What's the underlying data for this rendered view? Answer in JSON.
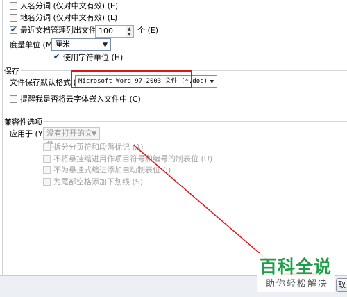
{
  "display": {
    "person_name_label": "人名分词 (仅对中文有效) (E)",
    "place_name_label": "地名分词 (仅对中文有效) (L)",
    "recent_docs_label": "最近文档管理列出文件 (R):",
    "recent_docs_value": "100",
    "recent_docs_unit": "个 (E)",
    "measure_unit_label": "度量单位 (M):",
    "measure_unit_value": "厘米",
    "char_unit_label": "使用字符单位 (H)"
  },
  "save": {
    "section_title": "保存",
    "default_format_label": "文件保存默认格式 (F):",
    "default_format_value": "Microsoft Word 97-2003 文件 (*.doc)",
    "cloud_font_label": "提醒我是否将云字体嵌入文件中 (C)"
  },
  "compat": {
    "section_title": "兼容性选项",
    "apply_to_label": "应用于 (Y):",
    "apply_to_value": "没有打开的文档",
    "options": [
      "拆分分页符和段落标记 (A)",
      "不将悬挂缩进用作项目符号和编号的制表位 (U)",
      "不为悬挂式缩进添加自动制表位 (I)",
      "为尾部空格添加下划线 (S)"
    ]
  },
  "watermark": {
    "title": "百科全说",
    "subtitle": "助你轻松解决"
  },
  "footer": {
    "partial_button": "取"
  },
  "colors": {
    "annotation_red": "#e0141e",
    "watermark_green": "#1f9e4a"
  }
}
